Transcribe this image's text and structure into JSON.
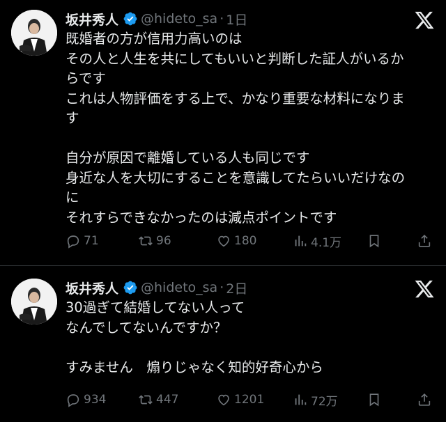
{
  "tweets": [
    {
      "author_name": "坂井秀人",
      "handle": "@hideto_sa",
      "separator": "·",
      "time": "1日",
      "lines": [
        "既婚者の方が信用力高いのは",
        "その人と人生を共にしてもいいと判断した証人がいるか",
        "らです",
        "これは人物評価をする上で、かなり重要な材料になりま",
        "す",
        "",
        "自分が原因で離婚している人も同じです",
        "身近な人を大切にすることを意識してたらいいだけなの",
        "に",
        "それすらできなかったのは減点ポイントです"
      ],
      "replies": "71",
      "retweets": "96",
      "likes": "180",
      "views": "4.1万"
    },
    {
      "author_name": "坂井秀人",
      "handle": "@hideto_sa",
      "separator": "·",
      "time": "2日",
      "lines": [
        "30過ぎて結婚してない人って",
        "なんでしてないんですか？",
        "",
        "すみません　煽りじゃなく知的好奇心から"
      ],
      "replies": "934",
      "retweets": "447",
      "likes": "1201",
      "views": "72万"
    }
  ],
  "icons": [
    "avatar",
    "verified-badge-icon",
    "x-logo-icon",
    "reply-icon",
    "retweet-icon",
    "like-icon",
    "views-icon",
    "bookmark-icon",
    "share-icon"
  ],
  "colors": {
    "background": "#000000",
    "text": "#e7e9ea",
    "muted": "#71767b",
    "verified": "#1d9bf0",
    "divider": "#2f3336"
  }
}
